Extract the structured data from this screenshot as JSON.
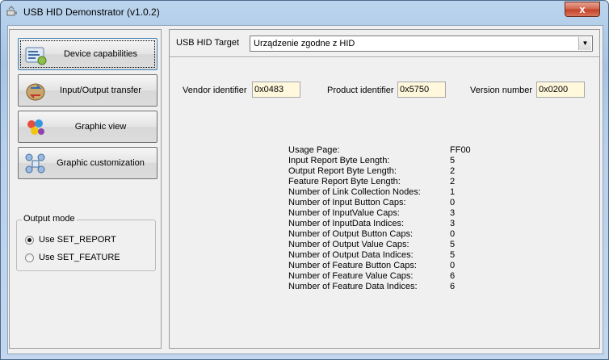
{
  "window": {
    "title": "USB HID Demonstrator (v1.0.2)",
    "close_label": "x"
  },
  "nav": [
    {
      "label": "Device capabilities",
      "icon": "device-capabilities-icon",
      "active": true
    },
    {
      "label": "Input/Output transfer",
      "icon": "io-transfer-icon",
      "active": false
    },
    {
      "label": "Graphic view",
      "icon": "graphic-view-icon",
      "active": false
    },
    {
      "label": "Graphic customization",
      "icon": "graphic-customization-icon",
      "active": false
    }
  ],
  "output_mode": {
    "title": "Output mode",
    "options": [
      {
        "label": "Use SET_REPORT",
        "selected": true
      },
      {
        "label": "Use SET_FEATURE",
        "selected": false
      }
    ]
  },
  "target": {
    "label": "USB HID Target",
    "selected": "Urządzenie zgodne z HID"
  },
  "ids": {
    "vendor_label": "Vendor identifier",
    "vendor_value": "0x0483",
    "product_label": "Product identifier",
    "product_value": "0x5750",
    "version_label": "Version number",
    "version_value": "0x0200"
  },
  "caps": [
    {
      "k": "Usage Page:",
      "v": "FF00"
    },
    {
      "k": "Input Report Byte Length:",
      "v": "5"
    },
    {
      "k": "Output Report Byte Length:",
      "v": "2"
    },
    {
      "k": "Feature Report Byte Length:",
      "v": "2"
    },
    {
      "k": "Number of Link Collection Nodes:",
      "v": "1"
    },
    {
      "k": "Number of Input Button Caps:",
      "v": "0"
    },
    {
      "k": "Number of InputValue Caps:",
      "v": "3"
    },
    {
      "k": "Number of InputData Indices:",
      "v": "3"
    },
    {
      "k": "Number of Output Button Caps:",
      "v": "0"
    },
    {
      "k": "Number of Output Value Caps:",
      "v": "5"
    },
    {
      "k": "Number of Output Data Indices:",
      "v": "5"
    },
    {
      "k": "Number of Feature Button Caps:",
      "v": "0"
    },
    {
      "k": "Number of Feature Value Caps:",
      "v": "6"
    },
    {
      "k": "Number of Feature Data Indices:",
      "v": "6"
    }
  ]
}
